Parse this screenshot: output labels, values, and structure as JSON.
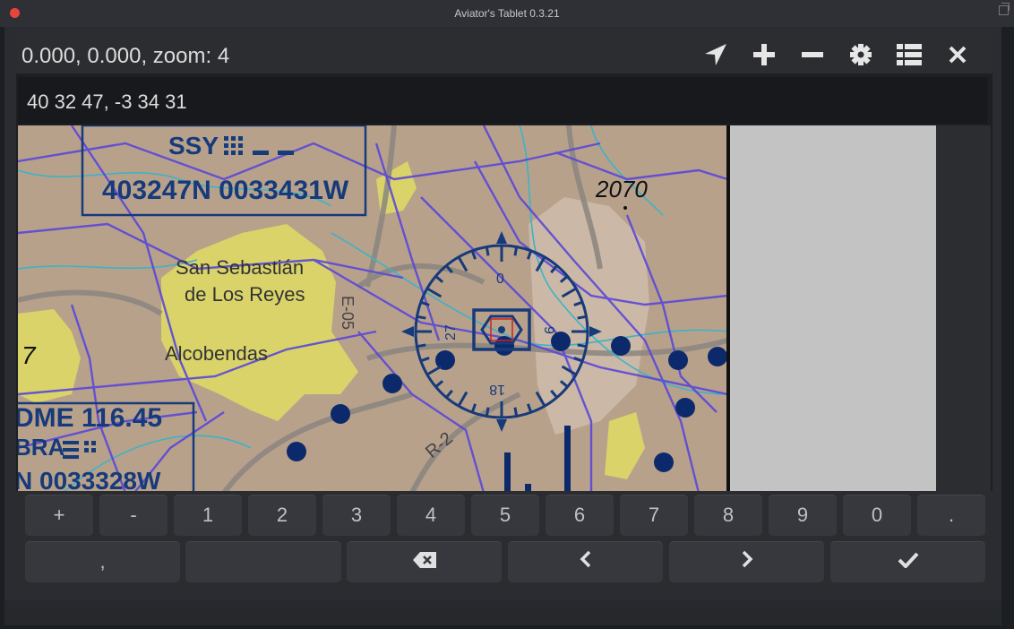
{
  "window": {
    "title": "Aviator's Tablet  0.3.21"
  },
  "toolbar": {
    "coords_text": "0.000, 0.000, zoom: 4",
    "icons": [
      "locate-icon",
      "zoom-in-icon",
      "zoom-out-icon",
      "settings-icon",
      "list-icon",
      "close-icon"
    ]
  },
  "input": {
    "value": "40 32 47, -3 34 31"
  },
  "map": {
    "labels": {
      "vor_ident": "SSY",
      "vor_coords": "403247N 0033431W",
      "elevation": "2070",
      "city1_line1": "San Sebastián",
      "city1_line2": "de Los Reyes",
      "city2": "Alcobendas",
      "road1": "E-05",
      "road2": "R-2",
      "partial_number": "7",
      "vor2_freq": "DME 116.45",
      "vor2_ident": "BRA",
      "vor2_coords": "N 0033328W",
      "rose_n": "0",
      "rose_w": "27",
      "rose_s": "18",
      "rose_e": "9"
    }
  },
  "keyboard": {
    "row1": [
      "+",
      "-",
      "1",
      "2",
      "3",
      "4",
      "5",
      "6",
      "7",
      "8",
      "9",
      "0",
      "."
    ],
    "row2": [
      ",",
      "",
      "backspace",
      "<",
      ">",
      "confirm"
    ]
  }
}
